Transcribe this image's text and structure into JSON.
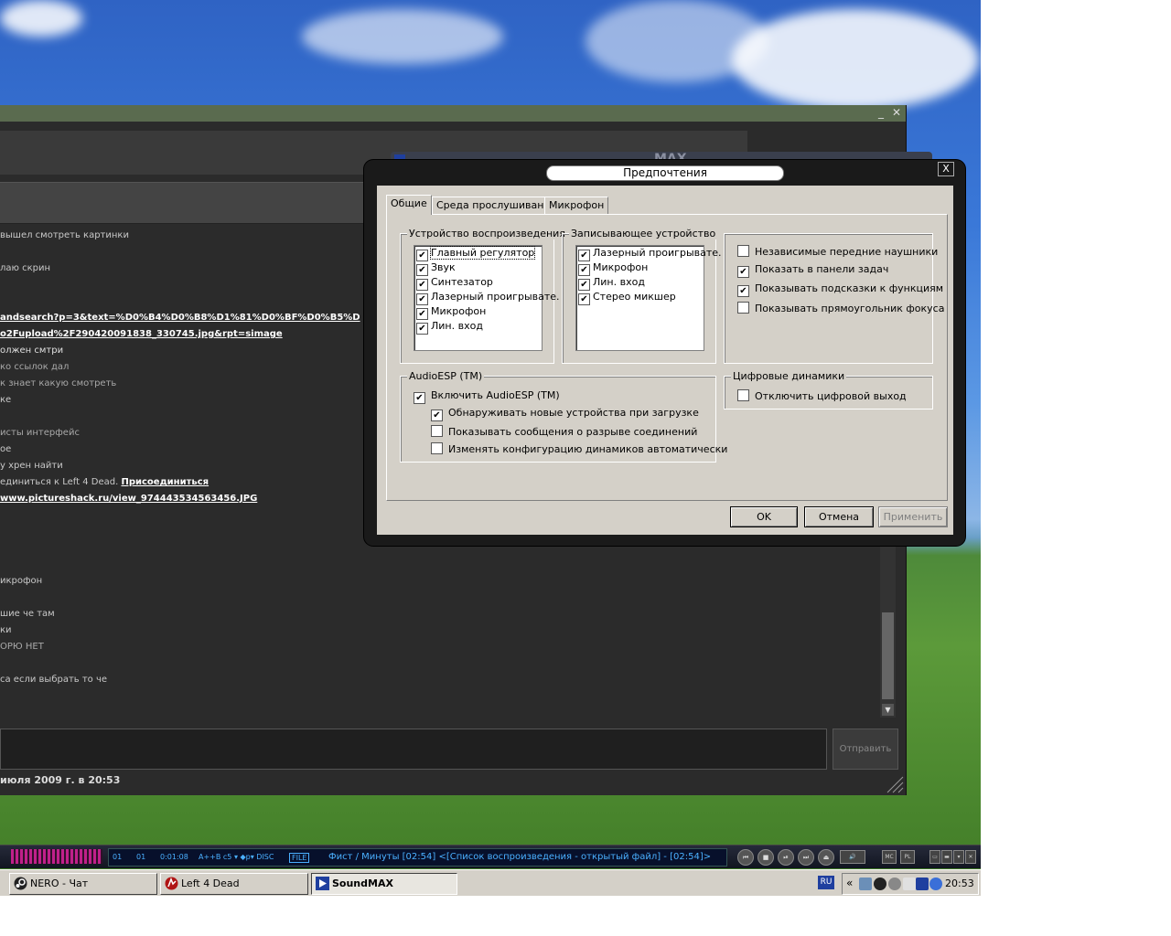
{
  "chat": {
    "messages": [
      {
        "text": "вышел смотреть картинки",
        "top": 0
      },
      {
        "text": "лаю скрин",
        "top": 0
      },
      {
        "text": "andsearch?p=3&text=%D0%B4%D0%B8%D1%81%D0%BF%D0%B5%D",
        "top": 0
      },
      {
        "text": "o2Fupload%2F290420091838_330745.jpg&rpt=simage",
        "top": 0
      },
      {
        "text": "олжен смтри",
        "top": 0
      },
      {
        "text": "ко ссылок дал",
        "top": 0
      },
      {
        "text": "к знает какую смотреть",
        "top": 0
      },
      {
        "text": "ке",
        "top": 0
      },
      {
        "text": "исты интерфейс",
        "top": 0
      },
      {
        "text": "ое",
        "top": 0
      },
      {
        "text": "у хрен найти",
        "top": 0
      },
      {
        "text": "единиться к Left 4 Dead.",
        "top": 0
      },
      {
        "text": "www.pictureshack.ru/view_974443534563456.JPG",
        "top": 0
      },
      {
        "text": "икрофон",
        "top": 0
      },
      {
        "text": "шие че там",
        "top": 0
      },
      {
        "text": "ки",
        "top": 0
      },
      {
        "text": "ОРЮ НЕТ",
        "top": 0
      },
      {
        "text": "са если выбрать то че",
        "top": 0
      }
    ],
    "join_link": "Присоединиться",
    "send_label": "Отправить",
    "date_line": "июля 2009 г. в 20:53",
    "minimize": "_",
    "close": "✕"
  },
  "soundmax_back": {
    "title_fragment": "MAX"
  },
  "dialog": {
    "title": "Предпочтения",
    "close": "X",
    "tabs": [
      "Общие",
      "Среда прослушивания",
      "Микрофон"
    ],
    "active_tab": 0,
    "playback": {
      "legend": "Устройство воспроизведения",
      "items": [
        {
          "label": "Главный регулятор",
          "checked": true
        },
        {
          "label": "Звук",
          "checked": true
        },
        {
          "label": "Синтезатор",
          "checked": true
        },
        {
          "label": "Лазерный проигрывате.",
          "checked": true
        },
        {
          "label": "Микрофон",
          "checked": true
        },
        {
          "label": "Лин. вход",
          "checked": true
        }
      ]
    },
    "recording": {
      "legend": "Записывающее устройство",
      "items": [
        {
          "label": "Лазерный проигрывате.",
          "checked": true
        },
        {
          "label": "Микрофон",
          "checked": true
        },
        {
          "label": "Лин. вход",
          "checked": true
        },
        {
          "label": "Стерео микшер",
          "checked": true
        }
      ]
    },
    "options": [
      {
        "label": "Независимые передние наушники",
        "checked": false
      },
      {
        "label": "Показать в панели задач",
        "checked": true
      },
      {
        "label": "Показывать подсказки к функциям",
        "checked": true
      },
      {
        "label": "Показывать прямоугольник фокуса",
        "checked": false
      }
    ],
    "audioesp": {
      "legend": "AudioESP (TM)",
      "enable": {
        "label": "Включить AudioESP (TM)",
        "checked": true
      },
      "sub": [
        {
          "label": "Обнаруживать новые устройства при загрузке",
          "checked": true
        },
        {
          "label": "Показывать сообщения о разрыве соединений",
          "checked": false
        },
        {
          "label": "Изменять конфигурацию динамиков автоматически",
          "checked": false
        }
      ]
    },
    "digital": {
      "legend": "Цифровые динамики",
      "option": {
        "label": "Отключить цифровой выход",
        "checked": false
      }
    },
    "buttons": {
      "ok": "OK",
      "cancel": "Отмена",
      "apply": "Применить"
    }
  },
  "winamp": {
    "track_num": "01",
    "track_num2": "01",
    "time": "0:01:08",
    "modes": "A++B  c5 ▾  ◆p▾   DISC",
    "file_badge": "FILE",
    "now_playing": "Фист / Минуты  [02:54]    <[Список воспроизведения - открытый файл] - [02:54]>",
    "mc": "MC",
    "pl": "PL"
  },
  "taskbar": {
    "items": [
      {
        "label": "NERO - Чат",
        "active": false
      },
      {
        "label": "Left 4 Dead",
        "active": false
      },
      {
        "label": "SoundMAX",
        "active": true
      }
    ],
    "lang": "RU",
    "tray_expand": "«",
    "clock": "20:53"
  },
  "colors": {
    "chat_bg": "#2b2b2b",
    "dialog_bg": "#d4d0c8",
    "winamp_text": "#4ab0ff"
  }
}
